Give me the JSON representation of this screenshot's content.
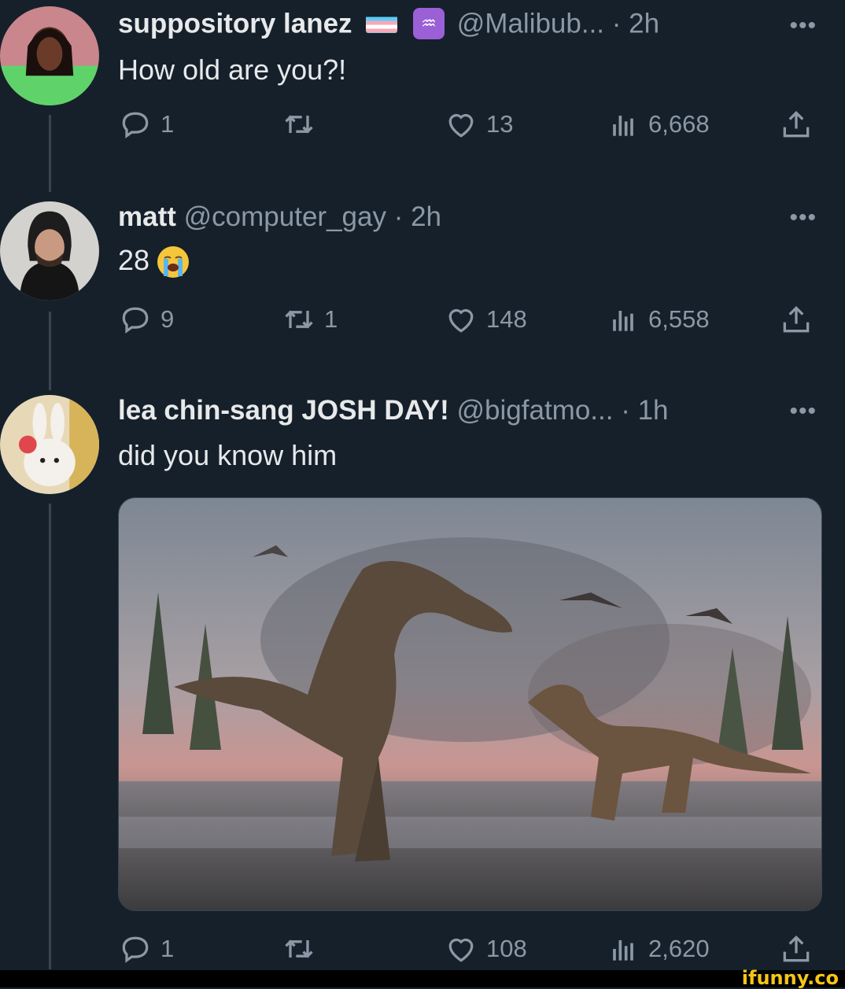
{
  "tweets": [
    {
      "name": "suppository lanez",
      "handle": "@Malibub...",
      "time": "· 2h",
      "text": "How old are you?!",
      "replies": "1",
      "retweets": "",
      "likes": "13",
      "views": "6,668"
    },
    {
      "name": "matt",
      "handle": "@computer_gay",
      "time": "· 2h",
      "text": "28",
      "replies": "9",
      "retweets": "1",
      "likes": "148",
      "views": "6,558"
    },
    {
      "name": "lea chin-sang JOSH DAY!",
      "handle": "@bigfatmo...",
      "time": "· 1h",
      "text": "did you know him",
      "replies": "1",
      "retweets": "",
      "likes": "108",
      "views": "2,620"
    }
  ],
  "more_label": "•••",
  "zodiac_symbol": "♒",
  "watermark": "ifunny.co",
  "colors": {
    "background": "#15202b",
    "text": "#e7e9ea",
    "muted": "#8b98a5",
    "thread_line": "#3a4550",
    "watermark": "#f7c519"
  }
}
